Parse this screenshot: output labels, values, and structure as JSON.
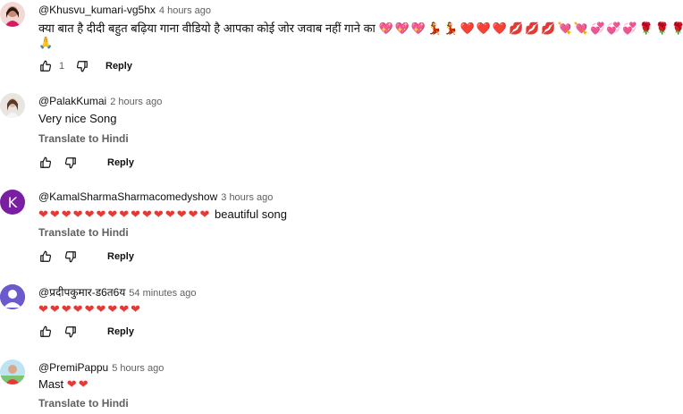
{
  "comments": [
    {
      "author": "@Khusvu_kumari-vg5hx",
      "time": "4 hours ago",
      "text": "क्या बात है दीदी बहुत बढ़िया गाना वीडियो है आपका कोई जोर जवाब नहीं गाने का",
      "emojis": "💖💖💖💃💃❤️❤️❤️💋💋💋💘💘💞💞💞🌹🌹🌹",
      "emojis_line2": "🙏",
      "likes": "1",
      "reply_label": "Reply"
    },
    {
      "author": "@PalakKumai",
      "time": "2 hours ago",
      "text": "Very nice Song",
      "translate_label": "Translate to Hindi",
      "reply_label": "Reply"
    },
    {
      "author": "@KamalSharmaSharmacomedyshow",
      "time": "3 hours ago",
      "avatar_letter": "K",
      "emojis": "❤❤❤❤❤❤❤❤❤❤❤❤❤❤❤",
      "text": "beautiful song",
      "translate_label": "Translate to Hindi",
      "reply_label": "Reply"
    },
    {
      "author": "@प्रदीपकुमार-ड6त6य",
      "time": "54 minutes ago",
      "emojis": "❤❤❤❤❤❤❤❤❤",
      "reply_label": "Reply"
    },
    {
      "author": "@PremiPappu",
      "time": "5 hours ago",
      "text": "Mast",
      "emojis": "❤❤",
      "translate_label": "Translate to Hindi"
    }
  ],
  "colors": {
    "text": "#0f0f0f",
    "meta": "#606060",
    "heart": "#e53935",
    "letter_avatar": "#7b1fa2"
  },
  "icons": {
    "like": "thumb-up-icon",
    "dislike": "thumb-down-icon"
  }
}
